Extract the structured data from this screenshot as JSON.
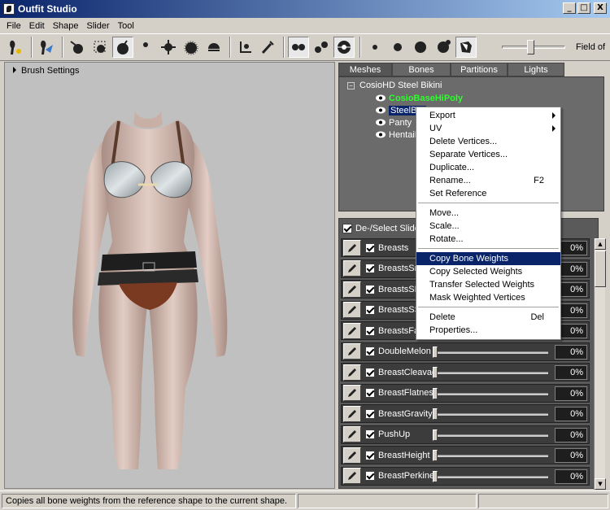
{
  "window": {
    "title": "Outfit Studio",
    "min": "_",
    "max": "□",
    "close": "X"
  },
  "menubar": {
    "file": "File",
    "edit": "Edit",
    "shape": "Shape",
    "slider": "Slider",
    "tool": "Tool"
  },
  "toolbar": {
    "tools": [
      "select-tool-icon",
      "transform-tool-icon",
      "brush-inflate-icon",
      "brush-mask-icon",
      "brush-deflate-icon",
      "brush-move-icon",
      "brush-smooth-icon",
      "brush-weight-icon",
      "brush-color-icon",
      "brush-alpha-icon",
      "pivot-icon",
      "eyedropper-icon"
    ],
    "active_tool": "brush-deflate-icon",
    "field_of_view_label": "Field of",
    "fov_level": 0.43
  },
  "viewport": {
    "brush_settings_label": "Brush Settings"
  },
  "tabs": [
    "Meshes",
    "Bones",
    "Partitions",
    "Lights"
  ],
  "active_tab": "Meshes",
  "meshes": {
    "root": "CosioHD Steel Bikini",
    "items": [
      {
        "label": "CosioBaseHiPoly",
        "state": "reference"
      },
      {
        "label": "SteelBra",
        "state": "selected"
      },
      {
        "label": "Panty",
        "state": "normal"
      },
      {
        "label": "HentaiB",
        "state": "normal"
      }
    ]
  },
  "sliders": {
    "select_all_label": "De-/Select Slide",
    "rows": [
      {
        "name": "Breasts",
        "value": "0%",
        "level": 0.0,
        "checked": true
      },
      {
        "name": "BreastsSma",
        "value": "0%",
        "level": 0.0,
        "checked": true
      },
      {
        "name": "BreastsSH",
        "value": "0%",
        "level": 0.0,
        "checked": true
      },
      {
        "name": "BreastsSSH",
        "value": "0%",
        "level": 0.0,
        "checked": true
      },
      {
        "name": "BreastsFant",
        "value": "0%",
        "level": 0.0,
        "checked": true
      },
      {
        "name": "DoubleMelon",
        "value": "0%",
        "level": 0.0,
        "checked": true
      },
      {
        "name": "BreastCleavage",
        "value": "0%",
        "level": 0.0,
        "checked": true
      },
      {
        "name": "BreastFlatness",
        "value": "0%",
        "level": 0.0,
        "checked": true
      },
      {
        "name": "BreastGravity",
        "value": "0%",
        "level": 0.0,
        "checked": true
      },
      {
        "name": "PushUp",
        "value": "0%",
        "level": 0.0,
        "checked": true
      },
      {
        "name": "BreastHeight",
        "value": "0%",
        "level": 0.0,
        "checked": true
      },
      {
        "name": "BreastPerkiness",
        "value": "0%",
        "level": 0.0,
        "checked": true
      }
    ]
  },
  "context_menu": {
    "export": "Export",
    "uv": "UV",
    "delete_vertices": "Delete Vertices...",
    "separate_vertices": "Separate Vertices...",
    "duplicate": "Duplicate...",
    "rename": "Rename...",
    "rename_shortcut": "F2",
    "set_reference": "Set Reference",
    "move": "Move...",
    "scale": "Scale...",
    "rotate": "Rotate...",
    "copy_bone_weights": "Copy Bone Weights",
    "copy_selected_weights": "Copy Selected Weights",
    "transfer_selected_weights": "Transfer Selected Weights",
    "mask_weighted_vertices": "Mask Weighted Vertices",
    "delete": "Delete",
    "delete_shortcut": "Del",
    "properties": "Properties..."
  },
  "statusbar": {
    "text": "Copies all bone weights from the reference shape to the current shape."
  },
  "colors": {
    "title_start": "#0a246a",
    "title_end": "#a6caf0",
    "menu_highlight": "#0a246a",
    "reference_mesh": "#2aff2a",
    "panel_bg": "#6b6b6b"
  }
}
